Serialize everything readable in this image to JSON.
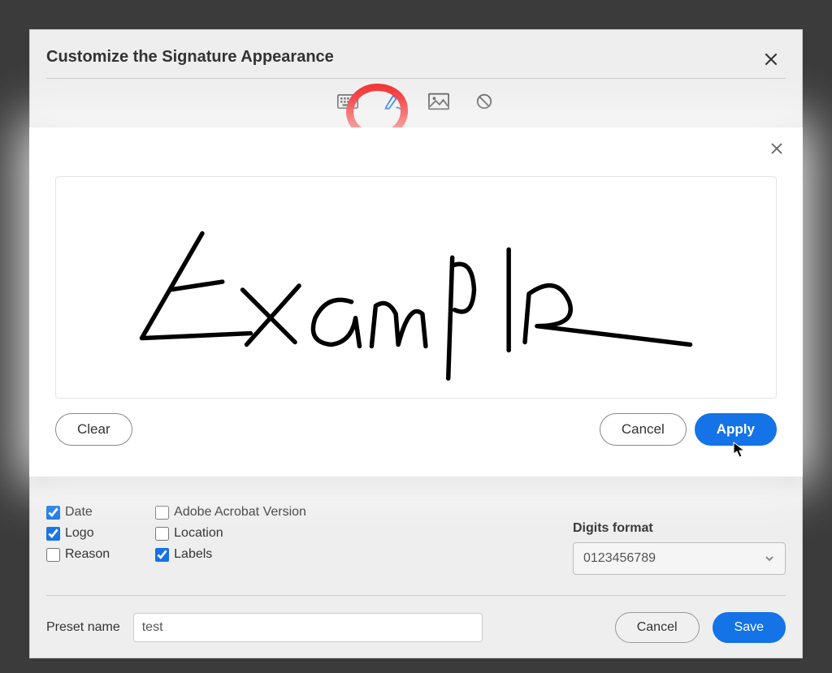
{
  "dialog": {
    "title": "Customize the Signature Appearance",
    "tabs": {
      "type": "keyboard-icon",
      "draw": "draw-icon",
      "image": "image-icon",
      "none": "none-icon"
    }
  },
  "checkboxes": {
    "date": {
      "label": "Date",
      "checked": true
    },
    "logo": {
      "label": "Logo",
      "checked": true
    },
    "reason": {
      "label": "Reason",
      "checked": false
    },
    "adobe_version": {
      "label": "Adobe Acrobat Version",
      "checked": false
    },
    "location": {
      "label": "Location",
      "checked": false
    },
    "labels": {
      "label": "Labels",
      "checked": true
    }
  },
  "digits": {
    "label": "Digits format",
    "value": "0123456789"
  },
  "preset": {
    "label": "Preset name",
    "value": "test"
  },
  "buttons": {
    "cancel": "Cancel",
    "save": "Save"
  },
  "draw_panel": {
    "signature_text": "Example",
    "clear": "Clear",
    "cancel": "Cancel",
    "apply": "Apply"
  }
}
